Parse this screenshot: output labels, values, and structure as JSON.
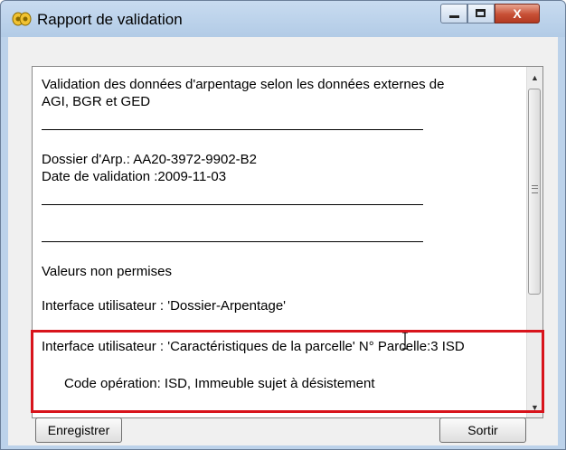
{
  "window": {
    "title": "Rapport de validation",
    "close_glyph": "X"
  },
  "report": {
    "lines": [
      "Validation des données d'arpentage selon les données externes de",
      "AGI, BGR et GED",
      "Dossier d'Arp.: AA20-3972-9902-B2",
      "Date de validation :2009-11-03",
      "Valeurs non permises",
      "Interface utilisateur : 'Dossier-Arpentage'",
      "Interface utilisateur : 'Caractéristiques de la parcelle' N° Parcelle:3 ISD",
      "Code opération: ISD, Immeuble sujet à désistement"
    ]
  },
  "buttons": {
    "save_label": "Enregistrer",
    "exit_label": "Sortir"
  },
  "colors": {
    "highlight": "#d8141c",
    "titlebar": "#c8dbf0"
  },
  "icons": [
    "app-icon",
    "minimize-icon",
    "maximize-icon",
    "close-icon",
    "scroll-up-arrow-icon",
    "scroll-down-arrow-icon",
    "text-cursor-icon"
  ]
}
